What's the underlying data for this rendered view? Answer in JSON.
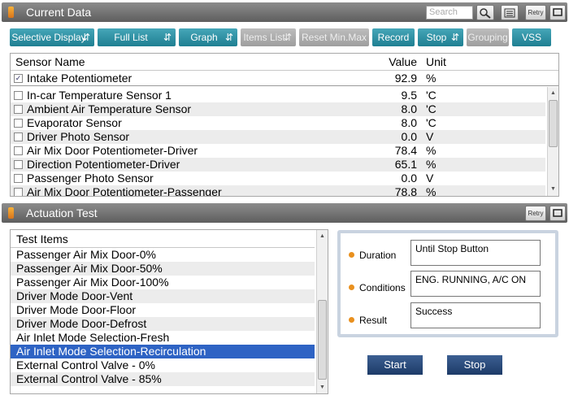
{
  "current_data": {
    "title": "Current Data",
    "search_placeholder": "Search",
    "retry_label": "Retry"
  },
  "toolbar": {
    "buttons": [
      {
        "label": "Selective Display",
        "dropdown": true,
        "enabled": true
      },
      {
        "label": "Full List",
        "dropdown": true,
        "enabled": true
      },
      {
        "label": "Graph",
        "dropdown": true,
        "enabled": true
      },
      {
        "label": "Items List",
        "dropdown": true,
        "enabled": false
      },
      {
        "label": "Reset Min.Max",
        "dropdown": false,
        "enabled": false
      },
      {
        "label": "Record",
        "dropdown": false,
        "enabled": true
      },
      {
        "label": "Stop",
        "dropdown": true,
        "enabled": true
      },
      {
        "label": "Grouping",
        "dropdown": false,
        "enabled": false
      },
      {
        "label": "VSS",
        "dropdown": false,
        "enabled": true
      }
    ]
  },
  "sensor_table": {
    "headers": {
      "name": "Sensor Name",
      "value": "Value",
      "unit": "Unit"
    },
    "pinned": {
      "name": "Intake Potentiometer",
      "value": "92.9",
      "unit": "%",
      "checked": true
    },
    "rows": [
      {
        "name": "In-car Temperature Sensor 1",
        "value": "9.5",
        "unit": "'C"
      },
      {
        "name": "Ambient Air Temperature Sensor",
        "value": "8.0",
        "unit": "'C"
      },
      {
        "name": "Evaporator Sensor",
        "value": "8.0",
        "unit": "'C"
      },
      {
        "name": "Driver Photo Sensor",
        "value": "0.0",
        "unit": "V"
      },
      {
        "name": "Air Mix Door Potentiometer-Driver",
        "value": "78.4",
        "unit": "%"
      },
      {
        "name": "Direction Potentiometer-Driver",
        "value": "65.1",
        "unit": "%"
      },
      {
        "name": "Passenger Photo Sensor",
        "value": "0.0",
        "unit": "V"
      },
      {
        "name": "Air Mix Door Potentiometer-Passenger",
        "value": "78.8",
        "unit": "%"
      }
    ]
  },
  "actuation_test": {
    "title": "Actuation Test",
    "retry_label": "Retry",
    "list_header": "Test Items",
    "items": [
      "Passenger Air Mix Door-0%",
      "Passenger Air Mix Door-50%",
      "Passenger Air Mix Door-100%",
      "Driver Mode Door-Vent",
      "Driver Mode Door-Floor",
      "Driver Mode Door-Defrost",
      "Air Inlet Mode Selection-Fresh",
      "Air Inlet Mode Selection-Recirculation",
      "External Control Valve - 0%",
      "External Control Valve - 85%"
    ],
    "selected_index": 7,
    "duration_label": "Duration",
    "duration_value": "Until Stop Button",
    "conditions_label": "Conditions",
    "conditions_value": "ENG. RUNNING, A/C ON",
    "result_label": "Result",
    "result_value": "Success",
    "start_label": "Start",
    "stop_label": "Stop"
  },
  "colors": {
    "toolbar_button": "#2a8fa3",
    "selection": "#2e63c4",
    "action_button": "#2a4a7c",
    "bullet": "#e9901e"
  }
}
